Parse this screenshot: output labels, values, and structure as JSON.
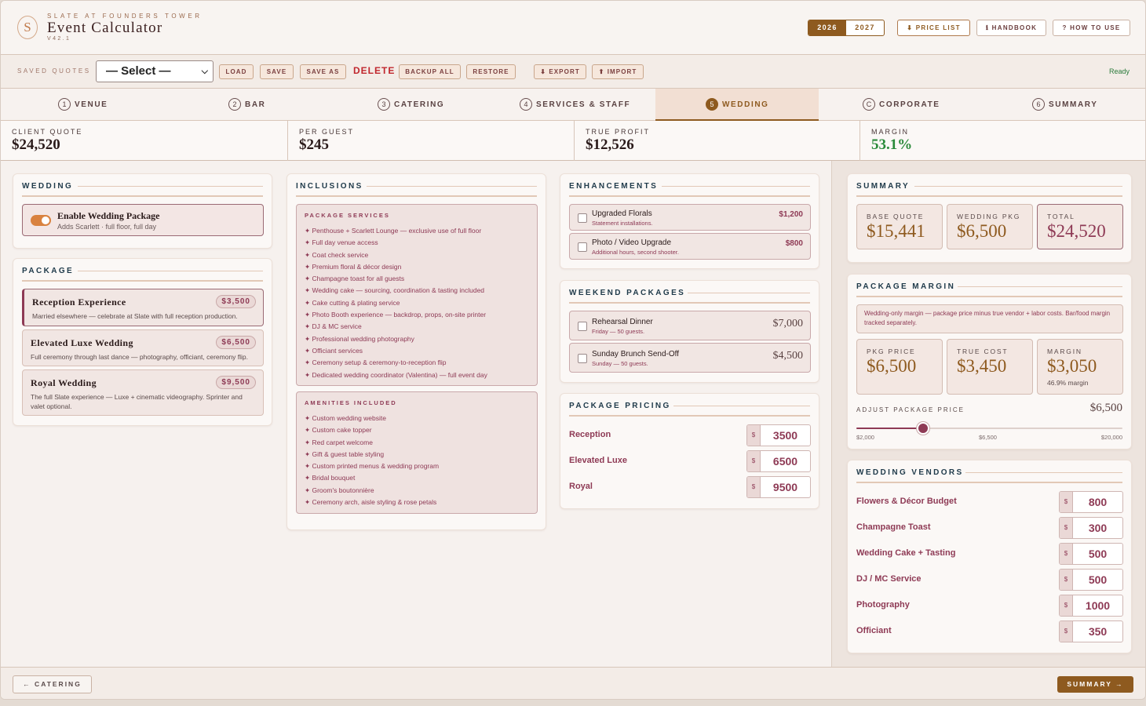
{
  "header": {
    "logo_letter": "S",
    "kicker": "SLATE AT FOUNDERS TOWER",
    "title": "Event Calculator",
    "version": "V42.1",
    "years": [
      "2026",
      "2027"
    ],
    "selected_year": "2026",
    "buttons": {
      "price_list": "⬇ PRICE LIST",
      "handbook": "ℹ HANDBOOK",
      "how_to_use": "? HOW TO USE"
    }
  },
  "toolbar": {
    "saved_quotes_label": "SAVED QUOTES",
    "select_value": "— Select —",
    "load": "LOAD",
    "save": "SAVE",
    "save_as": "SAVE AS",
    "delete": "DELETE",
    "backup_all": "BACKUP ALL",
    "restore": "RESTORE",
    "export": "⬇ EXPORT",
    "import": "⬆ IMPORT",
    "status": "Ready"
  },
  "tabs": [
    {
      "num": "1",
      "label": "VENUE"
    },
    {
      "num": "2",
      "label": "BAR"
    },
    {
      "num": "3",
      "label": "CATERING"
    },
    {
      "num": "4",
      "label": "SERVICES & STAFF"
    },
    {
      "num": "5",
      "label": "WEDDING"
    },
    {
      "num": "C",
      "label": "CORPORATE"
    },
    {
      "num": "6",
      "label": "SUMMARY"
    }
  ],
  "active_tab": "WEDDING",
  "metrics": [
    {
      "label": "CLIENT QUOTE",
      "value": "$24,520"
    },
    {
      "label": "PER GUEST",
      "value": "$245"
    },
    {
      "label": "TRUE PROFIT",
      "value": "$12,526"
    },
    {
      "label": "MARGIN",
      "value": "53.1%"
    }
  ],
  "wedding": {
    "title": "WEDDING",
    "toggle_title": "Enable Wedding Package",
    "toggle_sub": "Adds Scarlett · full floor, full day",
    "enabled": true
  },
  "package": {
    "title": "PACKAGE",
    "items": [
      {
        "name": "Reception Experience",
        "price": "$3,500",
        "desc": "Married elsewhere — celebrate at Slate with full reception production."
      },
      {
        "name": "Elevated Luxe Wedding",
        "price": "$6,500",
        "desc": "Full ceremony through last dance — photography, officiant, ceremony flip."
      },
      {
        "name": "Royal Wedding",
        "price": "$9,500",
        "desc": "The full Slate experience — Luxe + cinematic videography. Sprinter and valet optional."
      }
    ]
  },
  "inclusions": {
    "title": "INCLUSIONS",
    "services_title": "PACKAGE SERVICES",
    "services": [
      "✦ Penthouse + Scarlett Lounge — exclusive use of full floor",
      "✦ Full day venue access",
      "✦ Coat check service",
      "✦ Premium floral & décor design",
      "✦ Champagne toast for all guests",
      "✦ Wedding cake — sourcing, coordination & tasting included",
      "✦ Cake cutting & plating service",
      "✦ Photo Booth experience — backdrop, props, on-site printer",
      "✦ DJ & MC service",
      "✦ Professional wedding photography",
      "✦ Officiant services",
      "✦ Ceremony setup & ceremony-to-reception flip",
      "✦ Dedicated wedding coordinator (Valentina) — full event day"
    ],
    "amenities_title": "AMENITIES INCLUDED",
    "amenities": [
      "✦ Custom wedding website",
      "✦ Custom cake topper",
      "✦ Red carpet welcome",
      "✦ Gift & guest table styling",
      "✦ Custom printed menus & wedding program",
      "✦ Bridal bouquet",
      "✦ Groom's boutonnière",
      "✦ Ceremony arch, aisle styling & rose petals"
    ]
  },
  "enhancements": {
    "title": "ENHANCEMENTS",
    "items": [
      {
        "name": "Upgraded Florals",
        "sub": "Statement installations.",
        "price": "$1,200"
      },
      {
        "name": "Photo / Video Upgrade",
        "sub": "Additional hours, second shooter.",
        "price": "$800"
      }
    ]
  },
  "weekend": {
    "title": "WEEKEND PACKAGES",
    "items": [
      {
        "name": "Rehearsal Dinner",
        "sub": "Friday — 50 guests.",
        "price": "$7,000"
      },
      {
        "name": "Sunday Brunch Send-Off",
        "sub": "Sunday — 50 guests.",
        "price": "$4,500"
      }
    ]
  },
  "pricing": {
    "title": "PACKAGE PRICING",
    "currency": "$",
    "rows": [
      {
        "label": "Reception",
        "value": "3500"
      },
      {
        "label": "Elevated Luxe",
        "value": "6500"
      },
      {
        "label": "Royal",
        "value": "9500"
      }
    ]
  },
  "summary": {
    "title": "SUMMARY",
    "stats": [
      {
        "label": "BASE QUOTE",
        "value": "$15,441"
      },
      {
        "label": "WEDDING PKG",
        "value": "$6,500"
      },
      {
        "label": "TOTAL",
        "value": "$24,520"
      }
    ]
  },
  "margin": {
    "title": "PACKAGE MARGIN",
    "note": "Wedding-only margin — package price minus true vendor + labor costs. Bar/food margin tracked separately.",
    "stats": [
      {
        "label": "PKG PRICE",
        "value": "$6,500"
      },
      {
        "label": "TRUE COST",
        "value": "$3,450"
      },
      {
        "label": "MARGIN",
        "value": "$3,050",
        "sub": "46.9% margin"
      }
    ],
    "slider_label": "ADJUST PACKAGE PRICE",
    "slider_value": "$6,500",
    "slider_fraction": 0.25,
    "ticks": [
      "$2,000",
      "$6,500",
      "$20,000"
    ]
  },
  "vendors": {
    "title": "WEDDING VENDORS",
    "currency": "$",
    "rows": [
      {
        "label": "Flowers & Décor Budget",
        "value": "800"
      },
      {
        "label": "Champagne Toast",
        "value": "300"
      },
      {
        "label": "Wedding Cake + Tasting",
        "value": "500"
      },
      {
        "label": "DJ / MC Service",
        "value": "500"
      },
      {
        "label": "Photography",
        "value": "1000"
      },
      {
        "label": "Officiant",
        "value": "350"
      }
    ]
  },
  "footer": {
    "back": "← CATERING",
    "next": "SUMMARY →"
  },
  "colors": {
    "accent": "#8e5a1f",
    "wine": "#8e3a55",
    "navy": "#1f3a4a",
    "green": "#2a8a3a"
  }
}
